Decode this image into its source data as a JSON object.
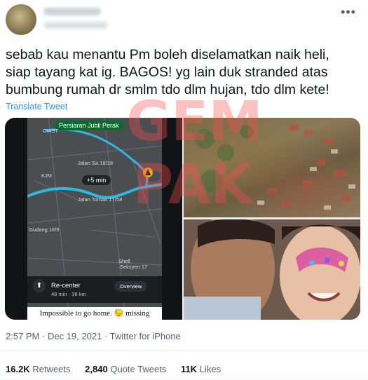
{
  "author": {
    "display_name": "",
    "handle": ""
  },
  "tweet": {
    "text": "sebab kau menantu Pm boleh diselamatkan naik heli,\nsiap tayang kat ig. BAGOS! yg lain duk stranded atas\nbumbung rumah dr smlm tdo dlm hujan, tdo dlm kete!",
    "translate_label": "Translate Tweet",
    "more_icon": "more-horizontal-icon"
  },
  "map_screenshot": {
    "destination": "Persiaran Jubli Perak",
    "route_eta_badge": "+5 min",
    "street_labels": [
      "CIAST",
      "Jalan Sa 18/18",
      "KJM",
      "Jalan Toman 17/58",
      "Gudang 16/9",
      "Shell",
      "Seksyen 17"
    ],
    "recenter_label": "Re-center",
    "eta": "48 min · 38 km",
    "overview_label": "Overview",
    "caption": "Impossible to go home. 😓 missing"
  },
  "meta": {
    "timestamp": "2:57 PM · Dec 19, 2021 · Twitter for iPhone"
  },
  "stats": {
    "retweets_count": "16.2K",
    "retweets_label": "Retweets",
    "quotes_count": "2,840",
    "quotes_label": "Quote Tweets",
    "likes_count": "11K",
    "likes_label": "Likes"
  },
  "colors": {
    "link": "#1d9bf0",
    "text": "#0f1419",
    "muted": "#536471",
    "route": "#2fb8e6",
    "watermark": "#ff4d4d"
  }
}
